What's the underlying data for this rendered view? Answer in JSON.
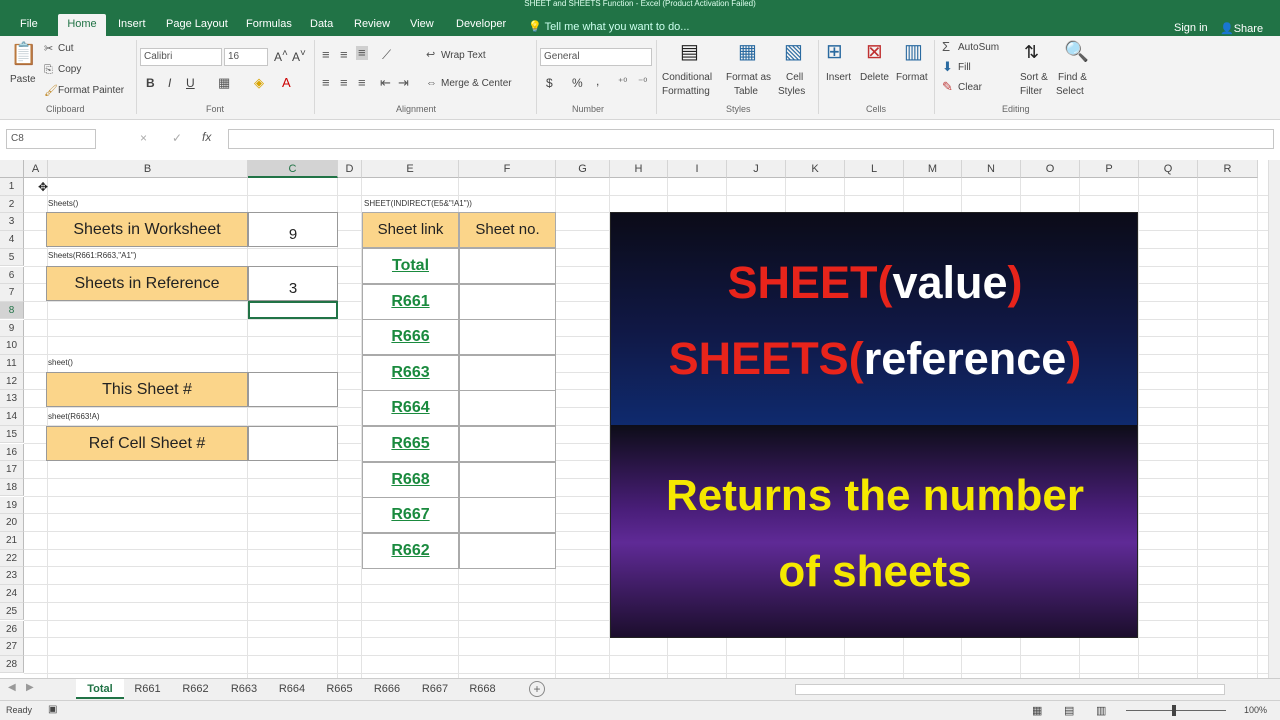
{
  "window": {
    "title": "SHEET and SHEETS Function - Excel (Product Activation Failed)"
  },
  "ribbon_tabs": [
    "File",
    "Home",
    "Insert",
    "Page Layout",
    "Formulas",
    "Data",
    "Review",
    "View",
    "Developer"
  ],
  "tell_me": "Tell me what you want to do...",
  "account": {
    "signin": "Sign in",
    "share": "Share"
  },
  "clipboard": {
    "paste": "Paste",
    "cut": "Cut",
    "copy": "Copy",
    "format_painter": "Format Painter",
    "group": "Clipboard"
  },
  "font": {
    "name": "Calibri",
    "size": "16",
    "group": "Font",
    "bold": "B",
    "italic": "I",
    "underline": "U"
  },
  "alignment": {
    "wrap": "Wrap Text",
    "merge": "Merge & Center",
    "group": "Alignment"
  },
  "number": {
    "format": "General",
    "currency": "$",
    "percent": "%",
    "comma": ",",
    "group": "Number"
  },
  "styles": {
    "cond": [
      "Conditional",
      "Formatting"
    ],
    "fmt_table": [
      "Format as",
      "Table"
    ],
    "cell_styles": [
      "Cell",
      "Styles"
    ],
    "group": "Styles"
  },
  "cells": {
    "insert": "Insert",
    "delete": "Delete",
    "format": "Format",
    "group": "Cells"
  },
  "editing": {
    "autosum": "AutoSum",
    "fill": "Fill",
    "clear": "Clear",
    "sort": [
      "Sort &",
      "Filter"
    ],
    "find": [
      "Find &",
      "Select"
    ],
    "group": "Editing"
  },
  "formula_bar": {
    "name_box": "C8",
    "fx": "fx",
    "cancel": "×",
    "enter": "✓"
  },
  "columns": [
    "A",
    "B",
    "C",
    "D",
    "E",
    "F",
    "G",
    "H",
    "I",
    "J",
    "K",
    "L",
    "M",
    "N",
    "O",
    "P",
    "Q",
    "R"
  ],
  "rows": [
    "1",
    "2",
    "3",
    "4",
    "5",
    "6",
    "7",
    "8",
    "9",
    "10",
    "11",
    "12",
    "13",
    "14",
    "15",
    "16",
    "17",
    "18",
    "19",
    "20",
    "21",
    "22",
    "23",
    "24",
    "25",
    "26",
    "27",
    "28"
  ],
  "cells_content": {
    "label_sheets": "Sheets()",
    "sheets_in_worksheet": "Sheets in Worksheet",
    "sheets_in_worksheet_val": "9",
    "label_sheets_ref": "Sheets(R661:R663,\"A1\")",
    "sheets_in_reference": "Sheets in Reference",
    "sheets_in_reference_val": "3",
    "label_sheet": "sheet()",
    "this_sheet": "This Sheet #",
    "label_sheet_ref": "sheet(R663!A)",
    "ref_cell_sheet": "Ref Cell Sheet #",
    "label_indirect": "SHEET(INDIRECT(E5&\"!A1\"))",
    "col_sheet_link": "Sheet link",
    "col_sheet_no": "Sheet no.",
    "links": [
      "Total",
      "R661",
      "R666",
      "R663",
      "R664",
      "R665",
      "R668",
      "R667",
      "R662"
    ]
  },
  "banner": {
    "line1_fn": "SHEET",
    "line1_paren_open": "(",
    "line1_arg": "value",
    "line1_paren_close": ")",
    "line2_fn": "SHEETS",
    "line2_paren_open": "(",
    "line2_arg": "reference",
    "line2_paren_close": ")",
    "line3": "Returns the number",
    "line4": "of sheets"
  },
  "sheet_tabs": [
    "Total",
    "R661",
    "R662",
    "R663",
    "R664",
    "R665",
    "R666",
    "R667",
    "R668"
  ],
  "status": {
    "ready": "Ready",
    "zoom": "100%"
  }
}
